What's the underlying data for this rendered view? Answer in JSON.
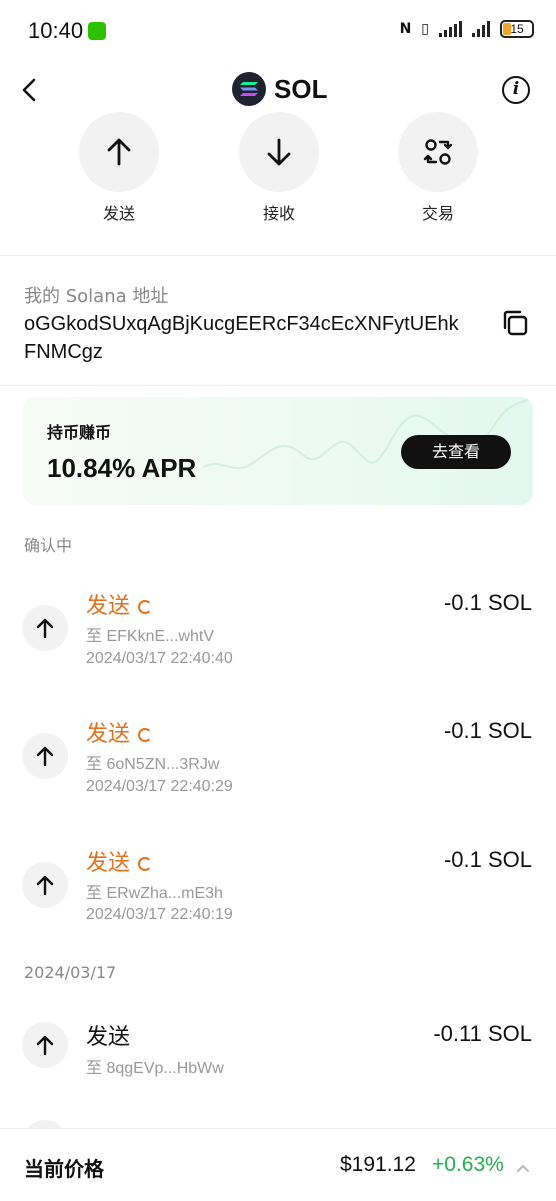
{
  "status_bar": {
    "time": "10:40",
    "battery": "15"
  },
  "header": {
    "title": "SOL"
  },
  "actions": [
    {
      "label": "发送",
      "icon": "arrow-up-icon"
    },
    {
      "label": "接收",
      "icon": "arrow-down-icon"
    },
    {
      "label": "交易",
      "icon": "swap-icon"
    }
  ],
  "address": {
    "label": "我的 Solana 地址",
    "value": "oGGkodSUxqAgBjKucgEERcF34cEcXNFytUEhkFNMCgz"
  },
  "earn_card": {
    "title": "持币赚币",
    "apr": "10.84% APR",
    "button": "去查看"
  },
  "pending_section": {
    "label": "确认中"
  },
  "pending_tx": [
    {
      "type": "发送",
      "to": "至 EFKknE...whtV",
      "time": "2024/03/17 22:40:40",
      "amount": "-0.1 SOL"
    },
    {
      "type": "发送",
      "to": "至 6oN5ZN...3RJw",
      "time": "2024/03/17 22:40:29",
      "amount": "-0.1 SOL"
    },
    {
      "type": "发送",
      "to": "至 ERwZha...mE3h",
      "time": "2024/03/17 22:40:19",
      "amount": "-0.1 SOL"
    }
  ],
  "date_section": {
    "label": "2024/03/17"
  },
  "history_tx": [
    {
      "type": "发送",
      "to": "至 8qgEVp...HbWw",
      "amount": "-0.11 SOL"
    }
  ],
  "bottom": {
    "price_label": "当前价格",
    "price": "$191.12",
    "change": "+0.63%"
  },
  "colors": {
    "pending": "#e0721e",
    "positive": "#22b14c",
    "button_bg": "#111111"
  }
}
